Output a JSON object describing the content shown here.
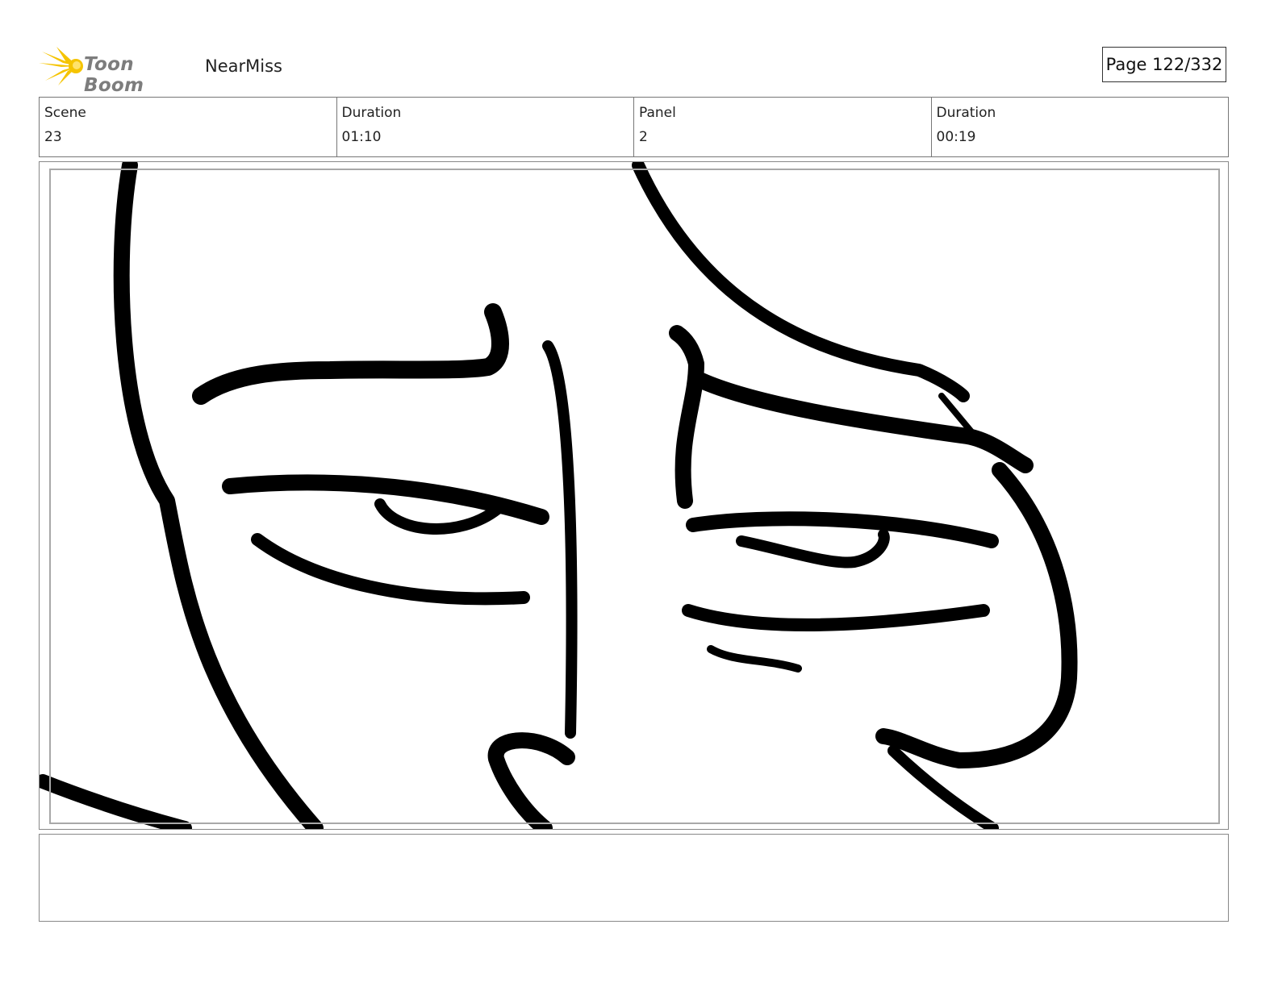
{
  "header": {
    "logo_text": "Toon Boom",
    "project_name": "NearMiss",
    "page_label": "Page 122/332"
  },
  "info": {
    "scene_label": "Scene",
    "scene_value": "23",
    "scene_duration_label": "Duration",
    "scene_duration_value": "01:10",
    "panel_label": "Panel",
    "panel_value": "2",
    "panel_duration_label": "Duration",
    "panel_duration_value": "00:19"
  },
  "notes": {
    "text": ""
  },
  "colors": {
    "logo_burst": "#f5c400",
    "logo_text": "#7d7d7d",
    "ink": "#000000"
  }
}
